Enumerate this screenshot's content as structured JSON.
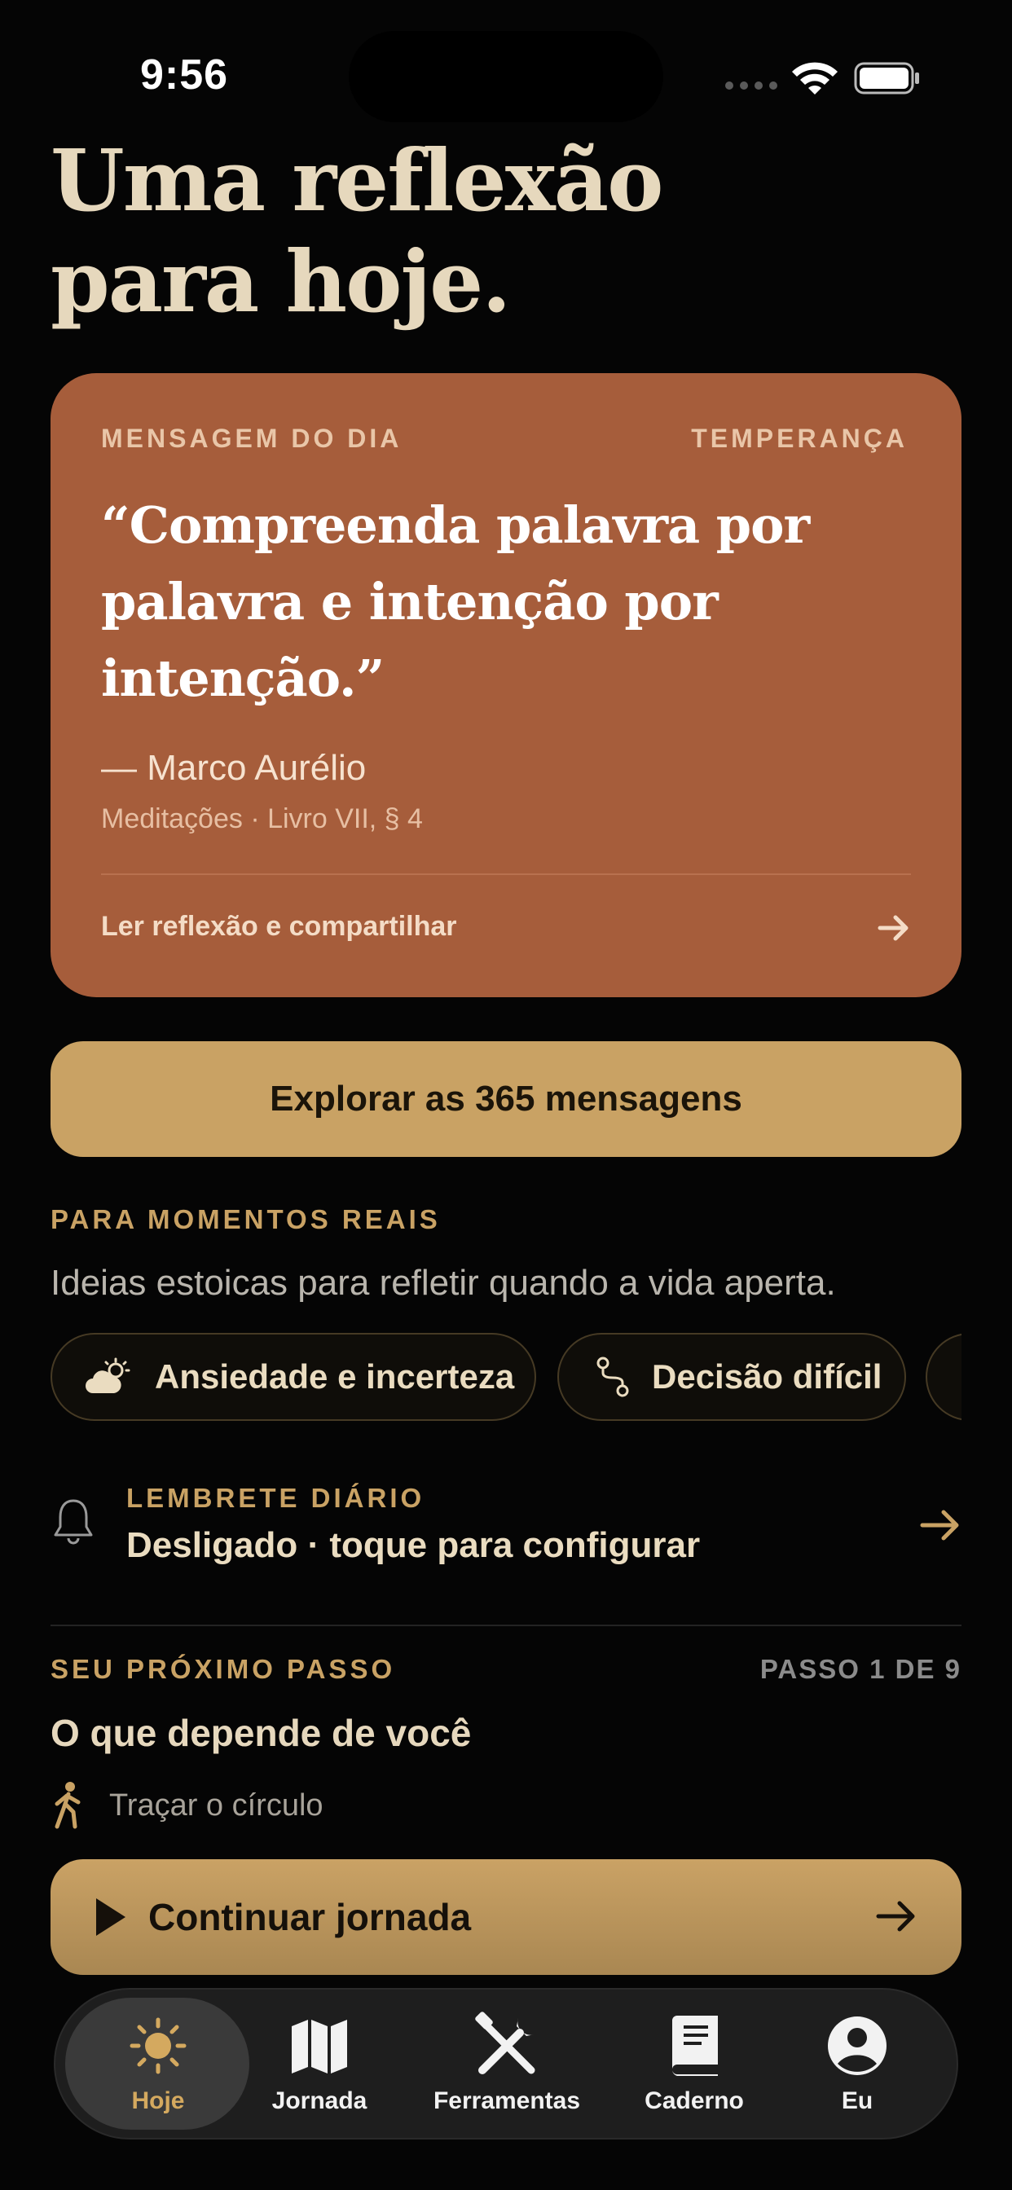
{
  "status_bar": {
    "time": "9:56"
  },
  "page": {
    "title_line1": "Uma reflexão",
    "title_line2": "para hoje."
  },
  "daily_card": {
    "eyebrow": "MENSAGEM DO DIA",
    "tag": "TEMPERANÇA",
    "quote_line1": "“Compreenda palavra por",
    "quote_line2": "palavra e intenção por",
    "quote_line3": "intenção.”",
    "author": "— Marco Aurélio",
    "source": "Meditações · Livro VII, § 4",
    "link_label": "Ler reflexão e compartilhar"
  },
  "explore": {
    "label": "Explorar as 365 mensagens"
  },
  "momentos": {
    "label": "PARA MOMENTOS REAIS",
    "subtitle": "Ideias estoicas para refletir quando a vida aperta.",
    "chips": [
      {
        "label": "Ansiedade e incerteza",
        "icon": "cloud-sun-icon"
      },
      {
        "label": "Decisão difícil",
        "icon": "route-icon"
      }
    ]
  },
  "reminder": {
    "label": "LEMBRETE DIÁRIO",
    "value": "Desligado · toque para configurar",
    "icon": "bell-icon"
  },
  "next_step": {
    "label": "SEU PRÓXIMO PASSO",
    "count": "PASSO 1 DE 9",
    "title": "O que depende de você",
    "subtitle": "Traçar o círculo",
    "icon": "walking-icon"
  },
  "continue": {
    "label": "Continuar jornada"
  },
  "tabbar": {
    "active": "Hoje",
    "items": [
      {
        "label": "Hoje",
        "icon": "sun-icon"
      },
      {
        "label": "Jornada",
        "icon": "map-icon"
      },
      {
        "label": "Ferramentas",
        "icon": "tools-icon"
      },
      {
        "label": "Caderno",
        "icon": "book-icon"
      },
      {
        "label": "Eu",
        "icon": "profile-icon"
      }
    ]
  },
  "colors": {
    "background": "#050505",
    "card": "#a65d3b",
    "accent": "#c9a264",
    "title": "#e6d8bd"
  }
}
